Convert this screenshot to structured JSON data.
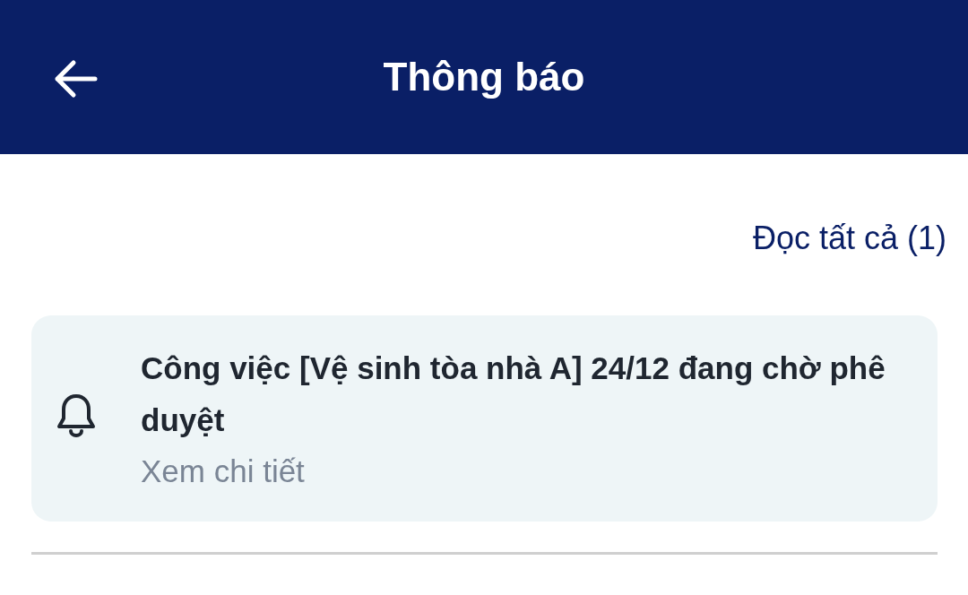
{
  "header": {
    "title": "Thông báo"
  },
  "read_all": "Đọc tất cả (1)",
  "notifications": [
    {
      "kind": "bell",
      "title": "Công việc [Vệ sinh tòa nhà A] 24/12 đang chờ phê duyệt",
      "link": "Xem chi tiết"
    }
  ]
}
